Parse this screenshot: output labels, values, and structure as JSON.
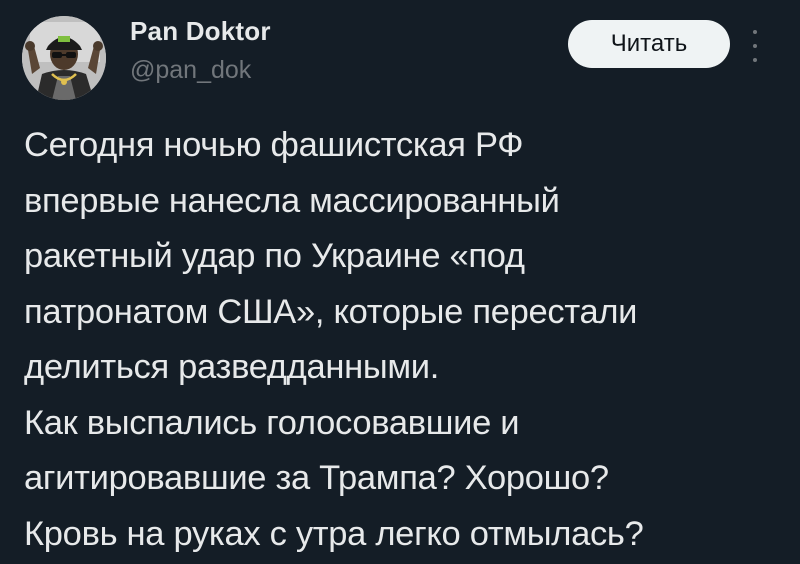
{
  "author": {
    "display_name": "Pan Doktor",
    "handle": "@pan_dok",
    "avatar_icon": "cartoon-avatar-icon"
  },
  "actions": {
    "follow_label": "Читать",
    "more_icon": "more-vertical-icon"
  },
  "tweet": {
    "lines": [
      "Сегодня ночью фашистская РФ",
      "впервые нанесла массированный",
      "ракетный удар по Украине «под",
      "патронатом США», которые перестали",
      "делиться разведданными.",
      "Как выспались голосовавшие и",
      "агитировавшие за Трампа? Хорошо?",
      "Кровь на руках с утра легко отмылась?"
    ]
  },
  "colors": {
    "background": "#141d26",
    "text_primary": "#e7e9ea",
    "text_secondary": "#71767b",
    "button_bg": "#eff3f4",
    "button_text": "#0f1419"
  }
}
